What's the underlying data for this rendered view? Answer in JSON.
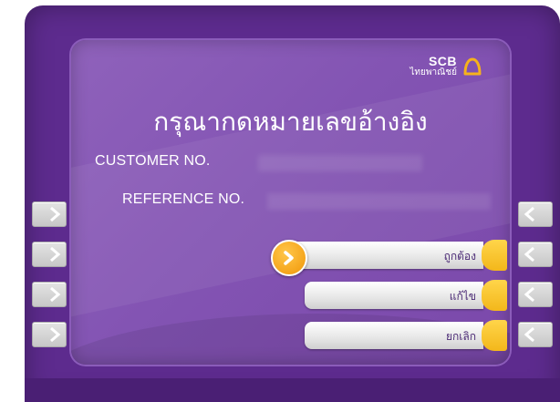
{
  "brand": {
    "name": "SCB",
    "thai_name": "ไทยพาณิชย์",
    "logo_icon": "bell-icon",
    "logo_color": "#f6b21b"
  },
  "screen": {
    "title": "กรุณากดหมายเลขอ้างอิง"
  },
  "fields": {
    "customer_label": "CUSTOMER NO.",
    "reference_label": "REFERENCE NO."
  },
  "options": [
    {
      "label": "ถูกต้อง",
      "selected": true
    },
    {
      "label": "แก้ไข",
      "selected": false
    },
    {
      "label": "ยกเลิก",
      "selected": false
    }
  ],
  "colors": {
    "frame": "#5d2b8e",
    "screen": "#8354b3",
    "accent": "#f5a51b",
    "button_text": "#4c2b76"
  },
  "icons": {
    "side_left": "chevron-right-icon",
    "side_right": "chevron-left-icon",
    "selected_marker": "arrow-right-icon"
  }
}
